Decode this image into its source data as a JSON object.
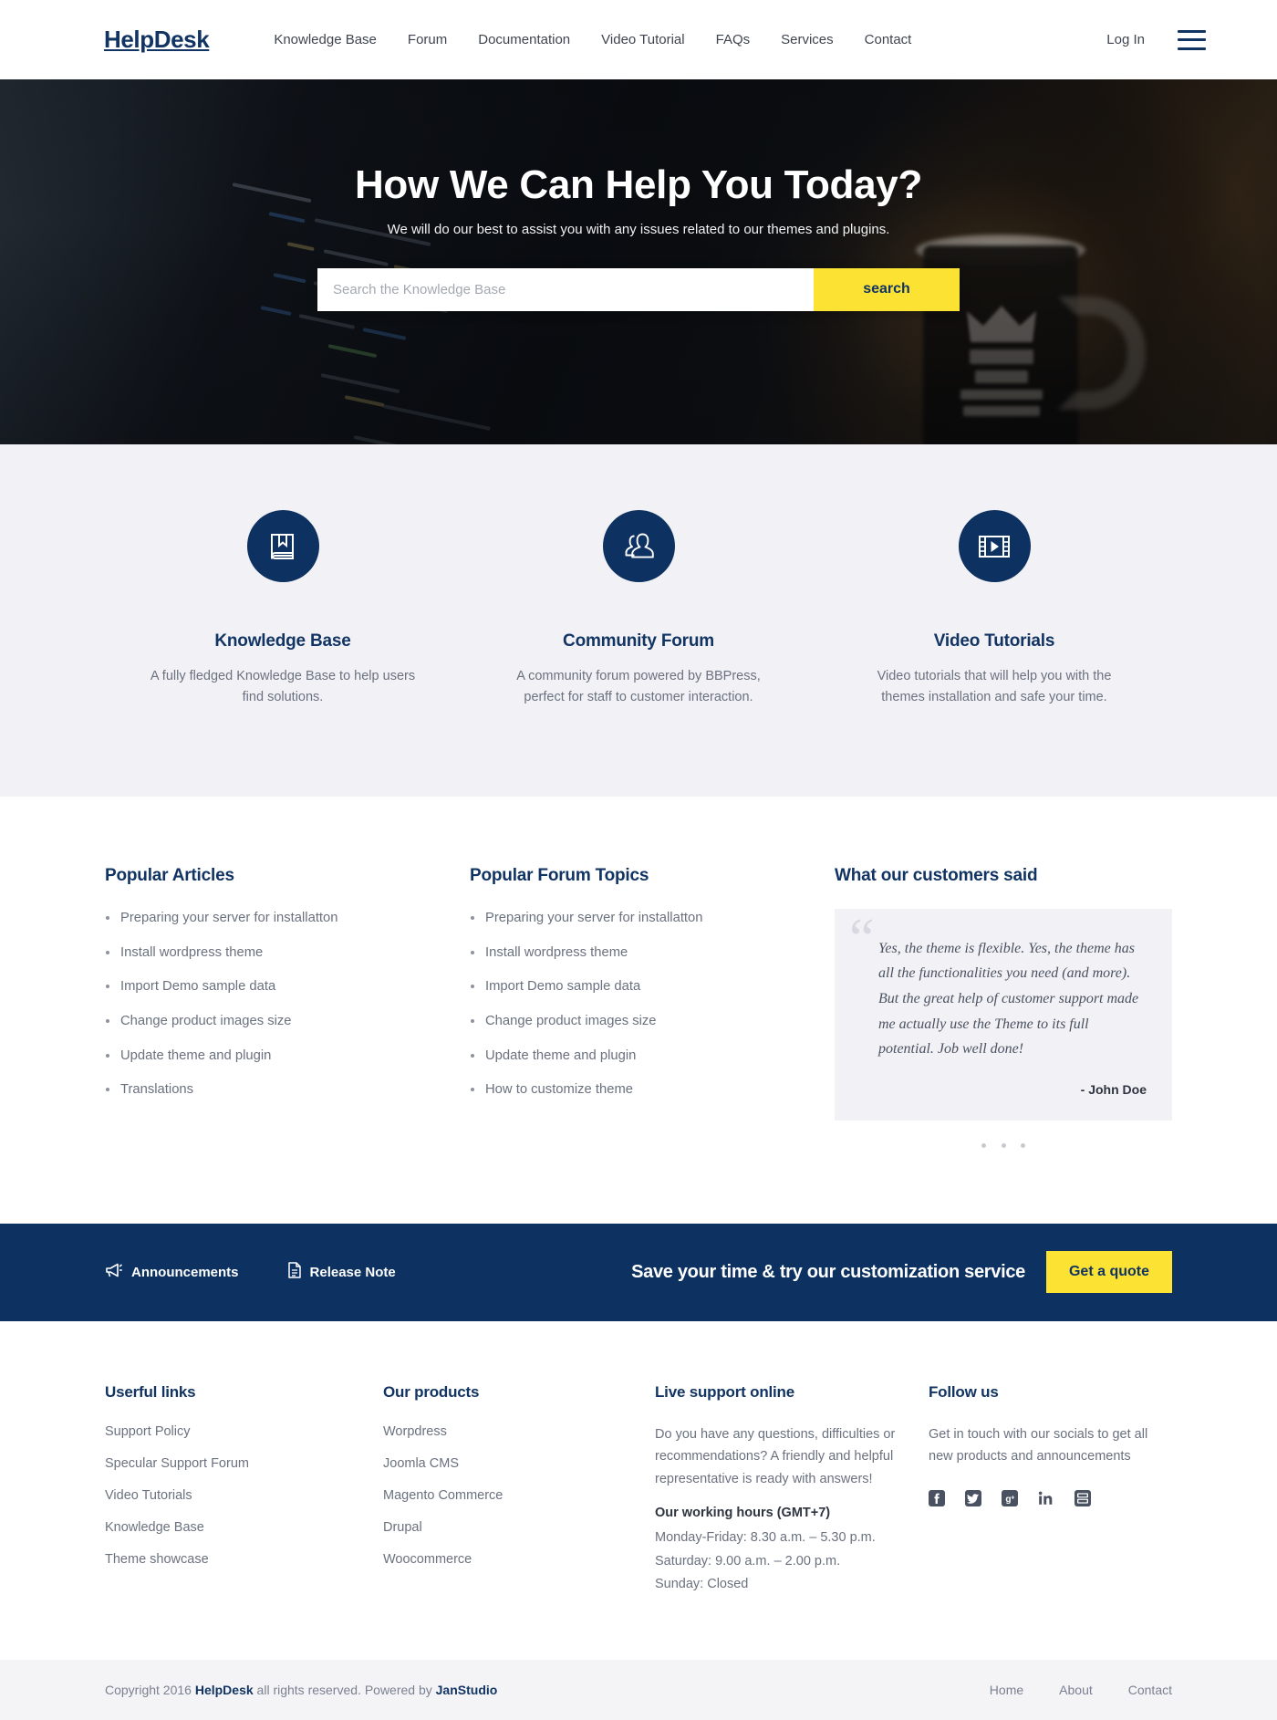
{
  "header": {
    "logo": "HelpDesk",
    "nav": [
      {
        "label": "Knowledge Base"
      },
      {
        "label": "Forum"
      },
      {
        "label": "Documentation"
      },
      {
        "label": "Video Tutorial"
      },
      {
        "label": "FAQs"
      },
      {
        "label": "Services"
      },
      {
        "label": "Contact"
      }
    ],
    "login_label": "Log In",
    "menu_icon": "hamburger-menu-icon"
  },
  "hero": {
    "title": "How We Can Help You Today?",
    "subtitle": "We will do our best to assist you with any issues related to our themes and plugins.",
    "search_placeholder": "Search the Knowledge Base",
    "search_value": "",
    "search_button": "search",
    "accent_color": "#fbe233",
    "brand_color": "#123463"
  },
  "features": [
    {
      "icon": "book-icon",
      "title": "Knowledge Base",
      "text": "A fully fledged Knowledge Base to help users find solutions."
    },
    {
      "icon": "users-icon",
      "title": "Community Forum",
      "text": "A community forum powered by BBPress, perfect for staff to customer interaction."
    },
    {
      "icon": "video-icon",
      "title": "Video Tutorials",
      "text": "Video tutorials that will help you with the themes installation and safe your time."
    }
  ],
  "popular_articles": {
    "title": "Popular Articles",
    "items": [
      "Preparing your server for installatton",
      "Install wordpress theme",
      "Import Demo sample data",
      "Change product images size",
      "Update theme and plugin",
      "Translations"
    ]
  },
  "popular_topics": {
    "title": "Popular Forum Topics",
    "items": [
      "Preparing your server for installatton",
      "Install wordpress theme",
      "Import Demo sample data",
      "Change product images size",
      "Update theme and plugin",
      "How to customize theme"
    ]
  },
  "testimonials": {
    "title": "What our customers said",
    "quote": "Yes, the theme is flexible. Yes, the theme has all the functionalities you need (and more). But the great help of customer support made me actually use the Theme to its full potential. Job well done!",
    "author": "- John Doe",
    "slide_count": 3
  },
  "cta": {
    "announcements_label": "Announcements",
    "announcements_icon": "megaphone-icon",
    "release_note_label": "Release Note",
    "release_note_icon": "document-icon",
    "headline": "Save your time & try our customization service",
    "button_label": "Get a quote",
    "background_color": "#0d3160"
  },
  "footer": {
    "useful_links": {
      "title": "Userful links",
      "items": [
        "Support Policy",
        "Specular Support Forum",
        "Video Tutorials",
        "Knowledge Base",
        "Theme showcase"
      ]
    },
    "products": {
      "title": "Our products",
      "items": [
        "Worpdress",
        "Joomla CMS",
        "Magento Commerce",
        "Drupal",
        "Woocommerce"
      ]
    },
    "live_support": {
      "title": "Live support online",
      "text": "Do you have any questions, difficulties or recommendations? A friendly and helpful  representative is ready with answers!",
      "hours_title": "Our working hours (GMT+7)",
      "hours": [
        "Monday-Friday: 8.30 a.m. – 5.30 p.m.",
        "Saturday: 9.00 a.m. – 2.00 p.m.",
        "Sunday: Closed"
      ]
    },
    "follow": {
      "title": "Follow us",
      "text": "Get in touch with our socials to get all new products and announcements",
      "socials": [
        {
          "name": "facebook-icon"
        },
        {
          "name": "twitter-icon"
        },
        {
          "name": "google-plus-icon"
        },
        {
          "name": "linkedin-icon"
        },
        {
          "name": "youtube-icon"
        }
      ]
    }
  },
  "copyright": {
    "prefix": "Copyright 2016 ",
    "brand": "HelpDesk",
    "middle": " all rights reserved. Powered by ",
    "author": "JanStudio",
    "nav": [
      {
        "label": "Home"
      },
      {
        "label": "About"
      },
      {
        "label": "Contact"
      }
    ]
  }
}
